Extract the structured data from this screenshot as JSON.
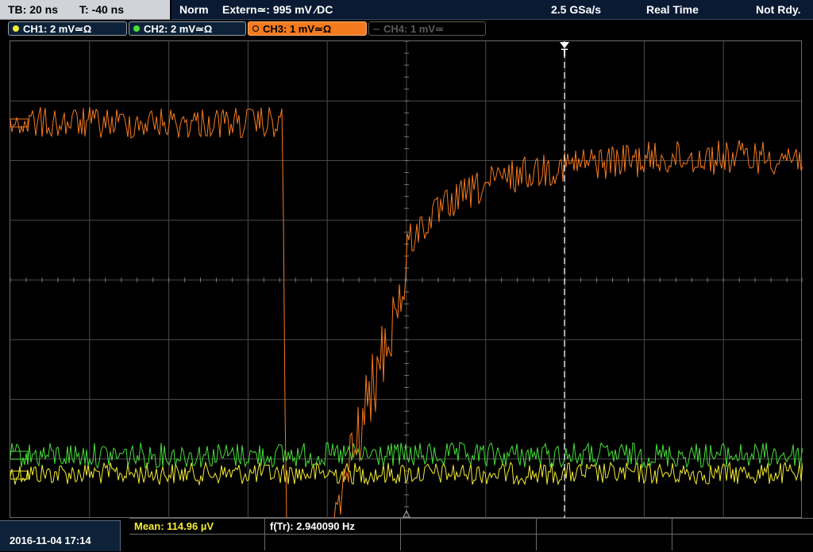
{
  "top_left": {
    "timebase": "TB: 20 ns",
    "trigger_time": "T: -40 ns"
  },
  "top_bar": {
    "trigger_mode": "Norm",
    "trigger_source": "Extern≃: 995 mV ∕DC",
    "sample_rate": "2.5 GSa/s",
    "acq_mode": "Real Time",
    "status": "Not Rdy."
  },
  "channels": [
    {
      "label": "CH1: 2 mV≃Ω",
      "color": "#f3ec33",
      "active": true
    },
    {
      "label": "CH2: 2 mV≃Ω",
      "color": "#46e03a",
      "active": true
    },
    {
      "label": "CH3: 1 mV≃Ω",
      "color": "#f57a1f",
      "active": true,
      "selected": true
    },
    {
      "label": "CH4: 1 mV≃",
      "color": "#555555",
      "active": false
    }
  ],
  "trigger_marker": "T",
  "bottom": {
    "datetime": "2016-11-04 17:14",
    "mean_label": "Mean: 114.96 µV",
    "freq_label": "f(Tr): 2.940090 Hz"
  },
  "colors": {
    "ch1": "#f3ec33",
    "ch2": "#46e03a",
    "ch3": "#f57a1f",
    "grid": "#4a4a4a",
    "header_bg": "#0b1a33"
  }
}
